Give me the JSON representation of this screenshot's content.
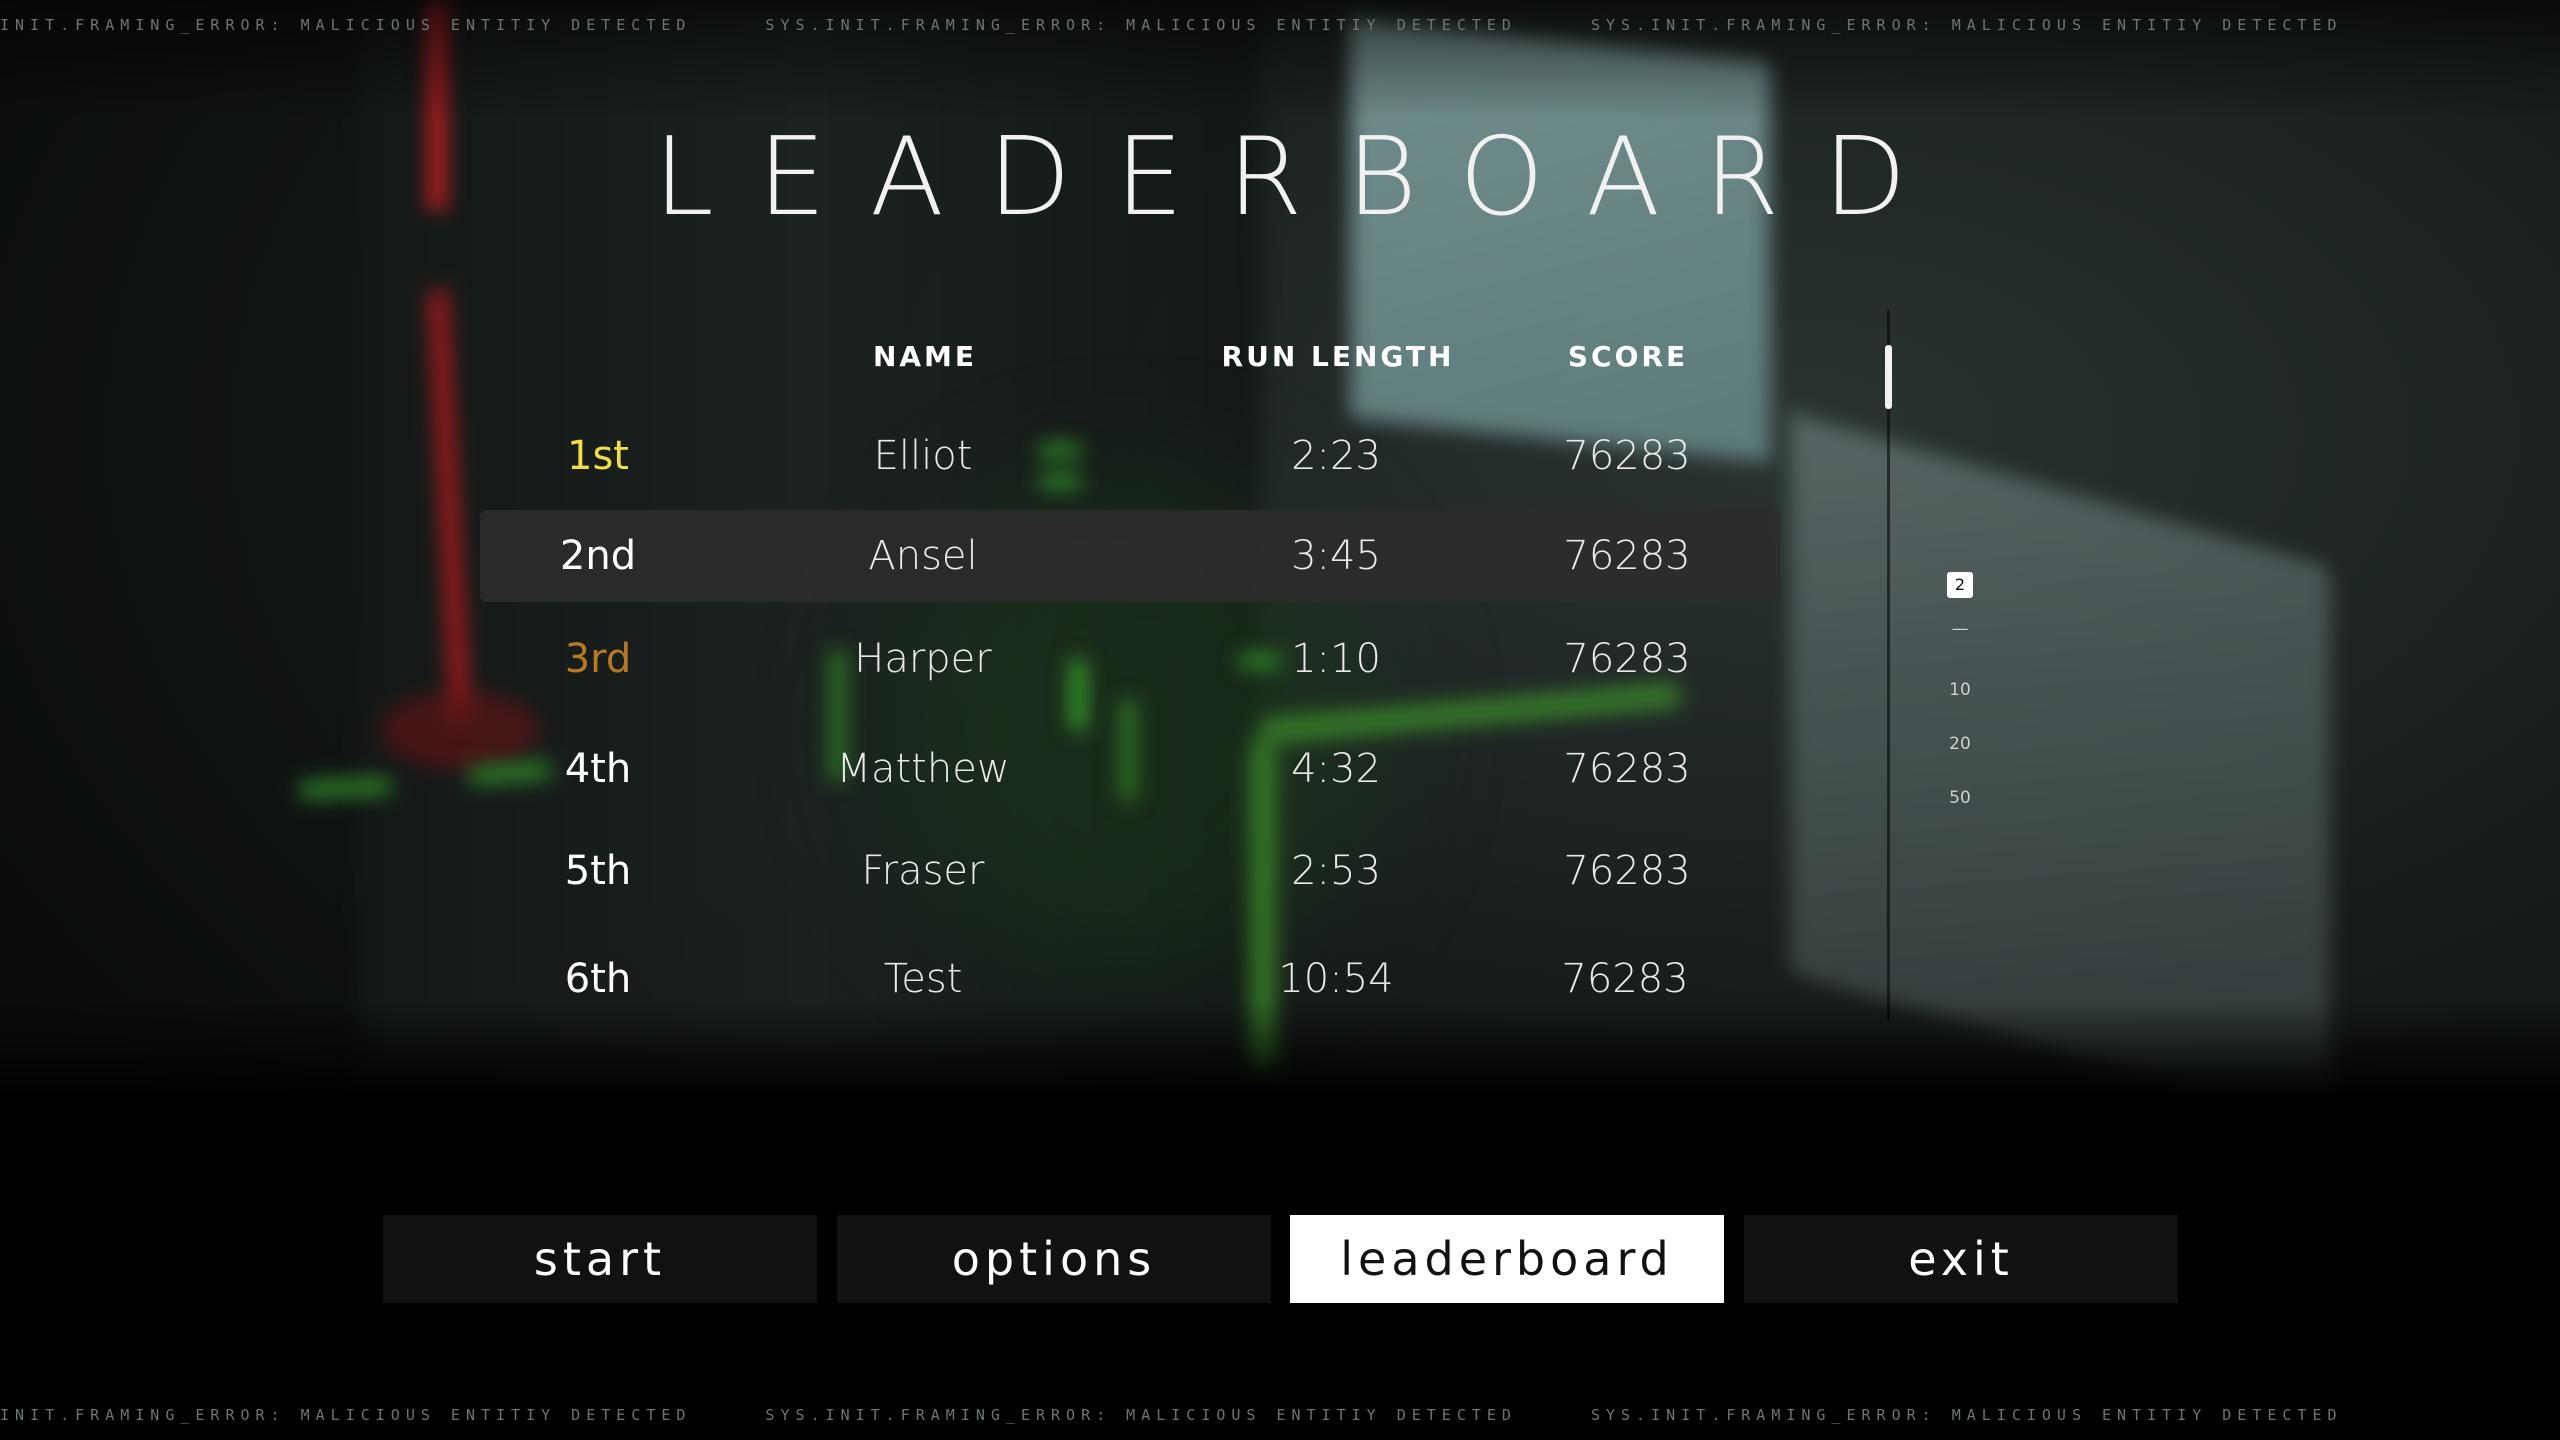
{
  "ticker": {
    "top": [
      "INIT.FRAMING_ERROR: MALICIOUS ENTITIY DETECTED",
      "SYS.INIT.FRAMING_ERROR: MALICIOUS ENTITIY DETECTED",
      "SYS.INIT.FRAMING_ERROR: MALICIOUS ENTITIY DETECTED"
    ],
    "bottom": [
      "INIT.FRAMING_ERROR: MALICIOUS ENTITIY DETECTED",
      "SYS.INIT.FRAMING_ERROR: MALICIOUS ENTITIY DETECTED",
      "SYS.INIT.FRAMING_ERROR: MALICIOUS ENTITIY DETECTED"
    ]
  },
  "title": "LEADERBOARD",
  "columns": {
    "name": "NAME",
    "run_length": "RUN LENGTH",
    "score": "SCORE"
  },
  "rows": [
    {
      "rank": "1st",
      "name": "Elliot",
      "run_length": "2:23",
      "score": "76283"
    },
    {
      "rank": "2nd",
      "name": "Ansel",
      "run_length": "3:45",
      "score": "76283"
    },
    {
      "rank": "3rd",
      "name": "Harper",
      "run_length": "1:10",
      "score": "76283"
    },
    {
      "rank": "4th",
      "name": "Matthew",
      "run_length": "4:32",
      "score": "76283"
    },
    {
      "rank": "5th",
      "name": "Fraser",
      "run_length": "2:53",
      "score": "76283"
    },
    {
      "rank": "6th",
      "name": "Test",
      "run_length": "10:54",
      "score": "76283"
    }
  ],
  "page_size": {
    "options": [
      "2",
      "—",
      "10",
      "20",
      "50"
    ],
    "selected": "2"
  },
  "menu": {
    "start": "start",
    "options": "options",
    "leaderboard": "leaderboard",
    "exit": "exit",
    "active": "leaderboard"
  },
  "colors": {
    "first_place": "#f3dd4a",
    "third_place": "#b87824",
    "active_button_bg": "#ffffff",
    "button_bg": "#111111"
  }
}
